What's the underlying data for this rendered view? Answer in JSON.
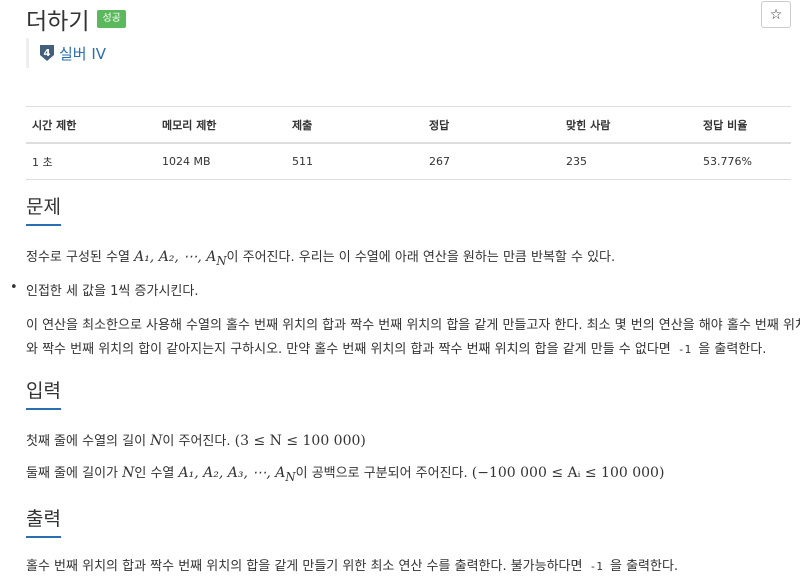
{
  "problem": {
    "title": "더하기",
    "status_badge": "성공",
    "tier_label": "실버 IV",
    "tier_number": "4",
    "favorite_icon": "☆"
  },
  "info_table": {
    "headers": [
      "시간 제한",
      "메모리 제한",
      "제출",
      "정답",
      "맞힌 사람",
      "정답 비율"
    ],
    "row": [
      "1 초",
      "1024 MB",
      "511",
      "267",
      "235",
      "53.776%"
    ]
  },
  "sections": {
    "problem": {
      "heading": "문제",
      "intro_before": "정수로 구성된 수열 ",
      "intro_math": "A₁, A₂, ⋯, A",
      "intro_math_sub": "N",
      "intro_after": "이 주어진다. 우리는 이 수열에 아래 연산을 원하는 만큼 반복할 수 있다.",
      "bullet_item": "인접한 세 값을 1씩 증가시킨다.",
      "body_line1": "이 연산을 최소한으로 사용해 수열의 홀수 번째 위치의 합과 짝수 번째 위치의 합을 같게 만들고자 한다. 최소 몇 번의 연산을 해야 홀수 번째 위치",
      "body_line2_before": "와 짝수 번째 위치의 합이 같아지는지 구하시오. 만약 홀수 번째 위치의 합과 짝수 번째 위치의 합을 같게 만들 수 없다면 ",
      "body_line2_code": "-1",
      "body_line2_after": " 을 출력한다."
    },
    "input": {
      "heading": "입력",
      "line1_before": "첫째 줄에 수열의 길이 ",
      "line1_math_var": "N",
      "line1_mid": "이 주어진다. ",
      "line1_math": "(3 ≤ N ≤ 100 000)",
      "line2_before": "둘째 줄에 길이가 ",
      "line2_var": "N",
      "line2_mid": "인 수열 ",
      "line2_math": "A₁, A₂, A₃, ⋯, A",
      "line2_math_sub": "N",
      "line2_after": "이 공백으로 구분되어 주어진다. ",
      "line2_range": "(−100 000 ≤ Aᵢ ≤ 100 000)"
    },
    "output": {
      "heading": "출력",
      "line_before": "홀수 번째 위치의 합과 짝수 번째 위치의 합을 같게 만들기 위한 최소 연산 수를 출력한다. 불가능하다면 ",
      "line_code": "-1",
      "line_after": " 을 출력한다."
    }
  },
  "colors": {
    "accent": "#2a6fb0",
    "success": "#5cb85c"
  }
}
